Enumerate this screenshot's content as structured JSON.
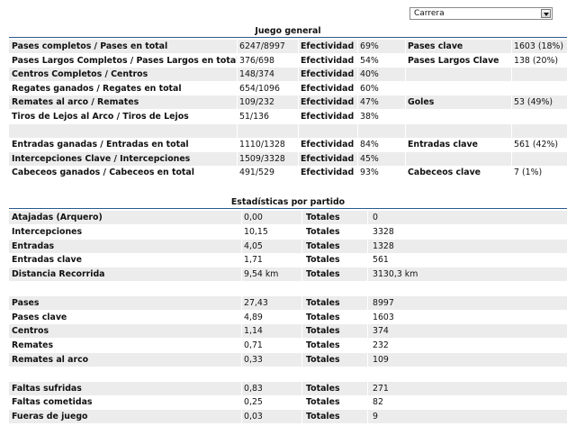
{
  "filter": {
    "selected": "Carrera"
  },
  "section1": {
    "title": "Juego general",
    "rows": [
      [
        "Pases completos / Pases en total",
        "6247/8997",
        "Efectividad",
        "69%",
        "Pases clave",
        "1603 (18%)"
      ],
      [
        "Pases Largos Completos / Pases Largos en total",
        "376/698",
        "Efectividad",
        "54%",
        "Pases Largos Clave",
        "138 (20%)"
      ],
      [
        "Centros Completos / Centros",
        "148/374",
        "Efectividad",
        "40%",
        "",
        ""
      ],
      [
        "Regates ganados / Regates en total",
        "654/1096",
        "Efectividad",
        "60%",
        "",
        ""
      ],
      [
        "Remates al arco / Remates",
        "109/232",
        "Efectividad",
        "47%",
        "Goles",
        "53 (49%)"
      ],
      [
        "Tiros de Lejos al Arco / Tiros de Lejos",
        "51/136",
        "Efectividad",
        "38%",
        "",
        ""
      ],
      [
        "",
        "",
        "",
        "",
        "",
        ""
      ],
      [
        "Entradas ganadas / Entradas en total",
        "1110/1328",
        "Efectividad",
        "84%",
        "Entradas clave",
        "561 (42%)"
      ],
      [
        "Intercepciones Clave / Intercepciones",
        "1509/3328",
        "Efectividad",
        "45%",
        "",
        ""
      ],
      [
        "Cabeceos ganados / Cabeceos en total",
        "491/529",
        "Efectividad",
        "93%",
        "Cabeceos clave",
        "7 (1%)"
      ]
    ]
  },
  "section2": {
    "title": "Estadísticas por partido",
    "rows": [
      [
        "Atajadas (Arquero)",
        "0,00",
        "Totales",
        "0"
      ],
      [
        "Intercepciones",
        "10,15",
        "Totales",
        "3328"
      ],
      [
        "Entradas",
        "4,05",
        "Totales",
        "1328"
      ],
      [
        "Entradas clave",
        "1,71",
        "Totales",
        "561"
      ],
      [
        "Distancia Recorrida",
        "9,54 km",
        "Totales",
        "3130,3 km"
      ],
      [
        "",
        "",
        "",
        ""
      ],
      [
        "Pases",
        "27,43",
        "Totales",
        "8997"
      ],
      [
        "Pases clave",
        "4,89",
        "Totales",
        "1603"
      ],
      [
        "Centros",
        "1,14",
        "Totales",
        "374"
      ],
      [
        "Remates",
        "0,71",
        "Totales",
        "232"
      ],
      [
        "Remates al arco",
        "0,33",
        "Totales",
        "109"
      ],
      [
        "",
        "",
        "",
        ""
      ],
      [
        "Faltas sufridas",
        "0,83",
        "Totales",
        "271"
      ],
      [
        "Faltas cometidas",
        "0,25",
        "Totales",
        "82"
      ],
      [
        "Fueras de juego",
        "0,03",
        "Totales",
        "9"
      ]
    ]
  }
}
